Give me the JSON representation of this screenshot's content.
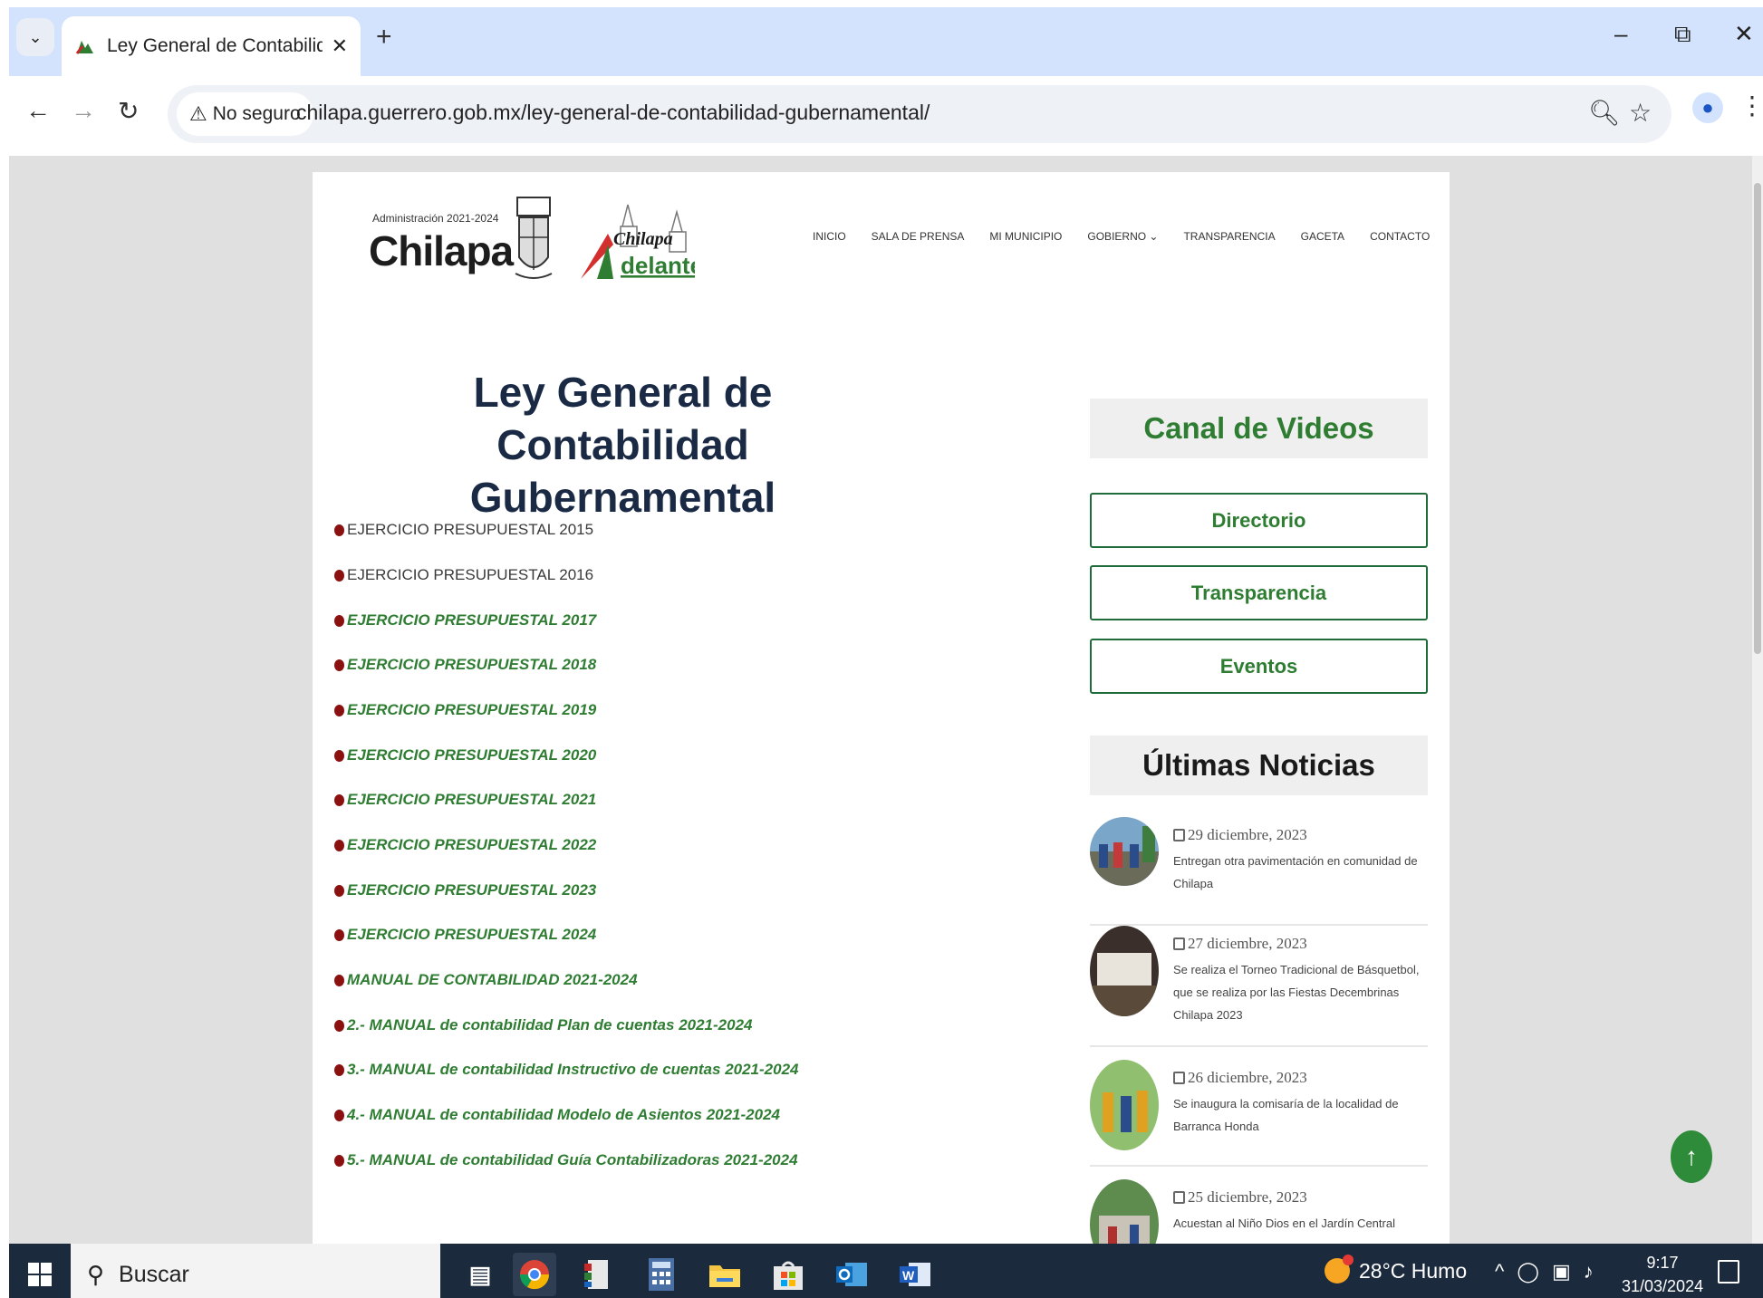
{
  "browser": {
    "tab_title": "Ley General de Contabilidad G…",
    "security_label": "No seguro",
    "url": "chilapa.guerrero.gob.mx/ley-general-de-contabilidad-gubernamental/"
  },
  "site": {
    "logo_admin": "Administración 2021-2024",
    "logo_name": "Chilapa",
    "logo_slogan_top": "Chilapa",
    "logo_slogan_bottom": "delante",
    "nav": [
      "INICIO",
      "SALA DE PRENSA",
      "MI MUNICIPIO",
      "GOBIERNO ⌄",
      "TRANSPARENCIA",
      "GACETA",
      "CONTACTO"
    ]
  },
  "main": {
    "title": "Ley General de Contabilidad Gubernamental",
    "documents": [
      {
        "label": "EJERCICIO PRESUPUESTAL 2015",
        "style": "plain"
      },
      {
        "label": "EJERCICIO PRESUPUESTAL 2016",
        "style": "plain"
      },
      {
        "label": "EJERCICIO PRESUPUESTAL  2017",
        "style": "link"
      },
      {
        "label": "EJERCICIO PRESUPUESTAL 2018",
        "style": "link"
      },
      {
        "label": "EJERCICIO PRESUPUESTAL 2019",
        "style": "link"
      },
      {
        "label": "EJERCICIO PRESUPUESTAL 2020",
        "style": "link"
      },
      {
        "label": "EJERCICIO PRESUPUESTAL 2021",
        "style": "link"
      },
      {
        "label": "EJERCICIO PRESUPUESTAL 2022",
        "style": "link"
      },
      {
        "label": "EJERCICIO PRESUPUESTAL 2023",
        "style": "link"
      },
      {
        "label": "EJERCICIO PRESUPUESTAL 2024",
        "style": "link"
      },
      {
        "label": "MANUAL DE CONTABILIDAD 2021-2024",
        "style": "link"
      },
      {
        "label": "2.- MANUAL de contabilidad Plan de cuentas 2021-2024",
        "style": "link"
      },
      {
        "label": "3.- MANUAL de contabilidad Instructivo de cuentas 2021-2024",
        "style": "link"
      },
      {
        "label": "4.- MANUAL de contabilidad Modelo de Asientos 2021-2024",
        "style": "link"
      },
      {
        "label": "5.- MANUAL de contabilidad Guía Contabilizadoras 2021-2024",
        "style": "link"
      }
    ]
  },
  "sidebar": {
    "videos_title": "Canal de Videos",
    "buttons": [
      "Directorio",
      "Transparencia",
      "Eventos"
    ],
    "news_title": "Últimas Noticias",
    "news": [
      {
        "date": "29 diciembre, 2023",
        "text": "Entregan otra pavimentación en comunidad de Chilapa"
      },
      {
        "date": "27 diciembre, 2023",
        "text": "Se realiza el Torneo Tradicional de Básquetbol, que se realiza por las Fiestas Decembrinas Chilapa 2023"
      },
      {
        "date": "26 diciembre, 2023",
        "text": "Se inaugura la comisaría de la localidad de Barranca Honda"
      },
      {
        "date": "25 diciembre, 2023",
        "text": "Acuestan al Niño Dios en el Jardín Central"
      }
    ]
  },
  "taskbar": {
    "search_label": "Buscar",
    "weather": "28°C  Humo",
    "time": "9:17",
    "date": "31/03/2024"
  },
  "colors": {
    "accent_green": "#2e7d32",
    "bullet_red": "#8b1111",
    "title_navy": "#1a2a44"
  }
}
